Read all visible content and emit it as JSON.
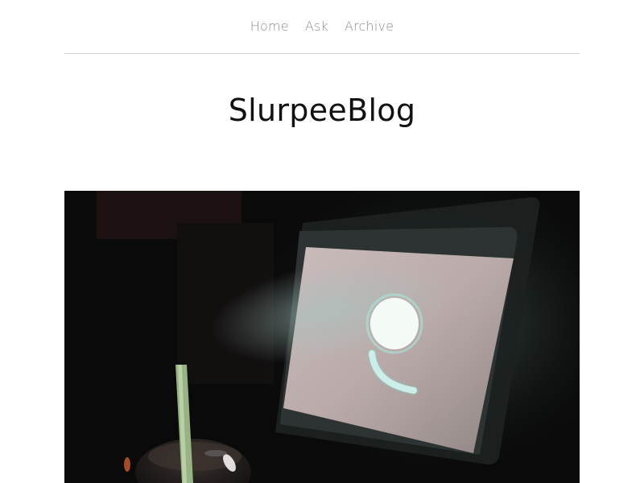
{
  "nav": {
    "items": [
      {
        "label": "Home"
      },
      {
        "label": "Ask"
      },
      {
        "label": "Archive"
      }
    ]
  },
  "blog": {
    "title": "SlurpeeBlog"
  },
  "post": {
    "photo_subject": "dark-photo-tablet-smiley-and-cup-straw"
  },
  "colors": {
    "nav_text": "#8a8a8a",
    "title_text": "#111111",
    "divider": "#d4d4d4",
    "background": "#ffffff"
  }
}
